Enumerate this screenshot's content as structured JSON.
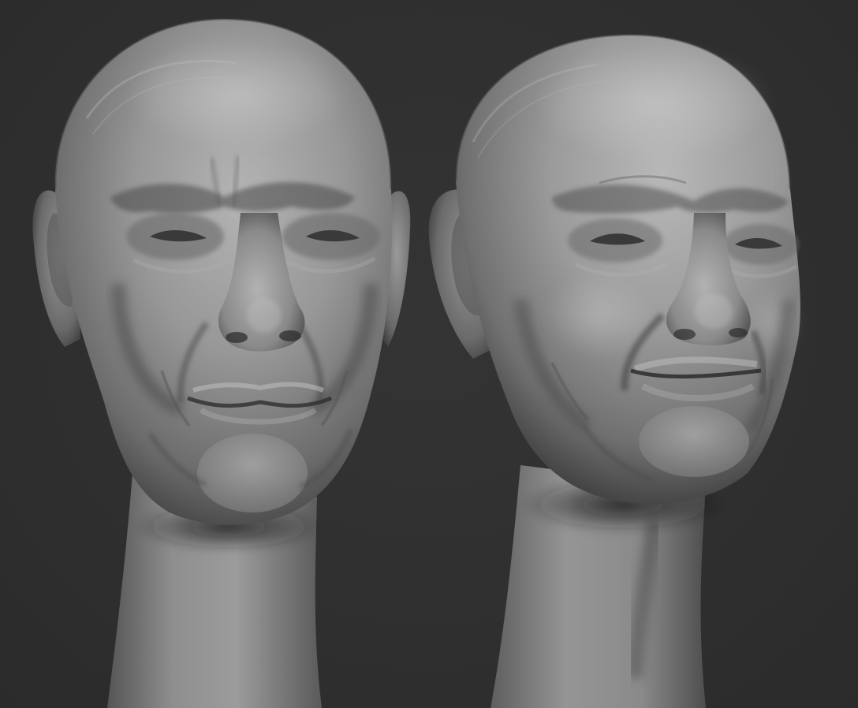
{
  "scene": {
    "background_color": "#2f2f2f",
    "material_color": "#8c8c8c",
    "subjects": [
      "elderly-head-sculpt-neutral",
      "elderly-head-sculpt-smiling"
    ]
  }
}
